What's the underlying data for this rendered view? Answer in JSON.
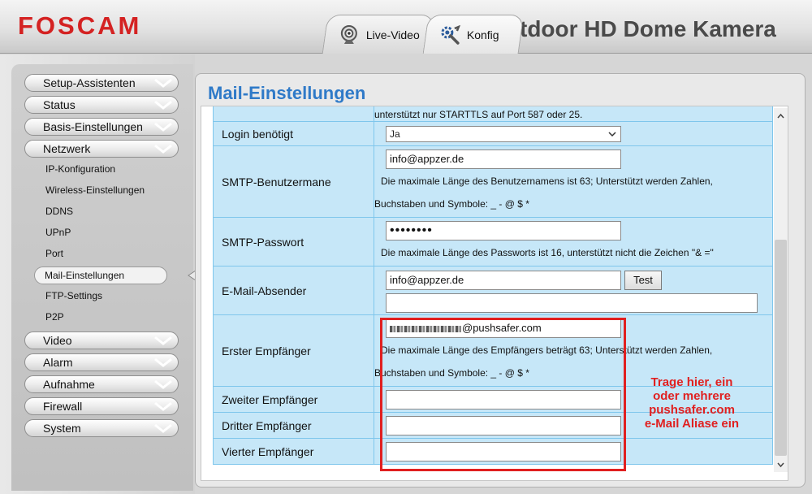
{
  "header": {
    "logo": "FOSCAM",
    "model_title": "tdoor HD Dome Kamera",
    "tabs": [
      {
        "label": "Live-Video",
        "icon": "webcam-icon"
      },
      {
        "label": "Konfig",
        "icon": "tools-icon"
      }
    ]
  },
  "sidebar": {
    "items": [
      {
        "label": "Setup-Assistenten"
      },
      {
        "label": "Status"
      },
      {
        "label": "Basis-Einstellungen"
      },
      {
        "label": "Netzwerk"
      }
    ],
    "sub_items": [
      {
        "label": "IP-Konfiguration"
      },
      {
        "label": "Wireless-Einstellungen"
      },
      {
        "label": "DDNS"
      },
      {
        "label": "UPnP"
      },
      {
        "label": "Port"
      },
      {
        "label": "Mail-Einstellungen",
        "active": true
      },
      {
        "label": "FTP-Settings"
      },
      {
        "label": "P2P"
      }
    ],
    "items_after": [
      {
        "label": "Video"
      },
      {
        "label": "Alarm"
      },
      {
        "label": "Aufnahme"
      },
      {
        "label": "Firewall"
      },
      {
        "label": "System"
      }
    ]
  },
  "main": {
    "title": "Mail-Einstellungen",
    "top_hint": "unterstützt nur STARTTLS auf Port 587 oder 25.",
    "login": {
      "label": "Login benötigt",
      "value": "Ja"
    },
    "smtp_user": {
      "label": "SMTP-Benutzermane",
      "value": "info@appzer.de",
      "hint1": "Die maximale Länge des Benutzernamens ist 63; Unterstützt werden Zahlen,",
      "hint2": "Buchstaben und Symbole: _ - @ $ *"
    },
    "smtp_pass": {
      "label": "SMTP-Passwort",
      "value": "••••••••",
      "hint": "Die maximale Länge des Passworts ist 16, unterstützt nicht die Zeichen \"& =\""
    },
    "sender": {
      "label": "E-Mail-Absender",
      "value": "info@appzer.de",
      "test_button": "Test",
      "test_result": ""
    },
    "first_recipient": {
      "label": "Erster Empfänger",
      "value": "@pushsafer.com",
      "hint1": "Die maximale Länge des Empfängers beträgt 63; Unterstützt werden Zahlen,",
      "hint2": "Buchstaben und Symbole: _ - @ $ *"
    },
    "second_recipient": {
      "label": "Zweiter Empfänger",
      "value": ""
    },
    "third_recipient": {
      "label": "Dritter Empfänger",
      "value": ""
    },
    "fourth_recipient": {
      "label": "Vierter Empfänger",
      "value": ""
    }
  },
  "annotation": {
    "line1": "Trage hier, ein",
    "line2": "oder mehrere",
    "line3": "pushsafer.com",
    "line4": "e-Mail Aliase ein",
    "color": "#e02020"
  },
  "colors": {
    "brand_red": "#d42222",
    "title_blue": "#2f7ac8",
    "table_bg": "#c6e7f8",
    "table_border": "#7fc6ec"
  }
}
